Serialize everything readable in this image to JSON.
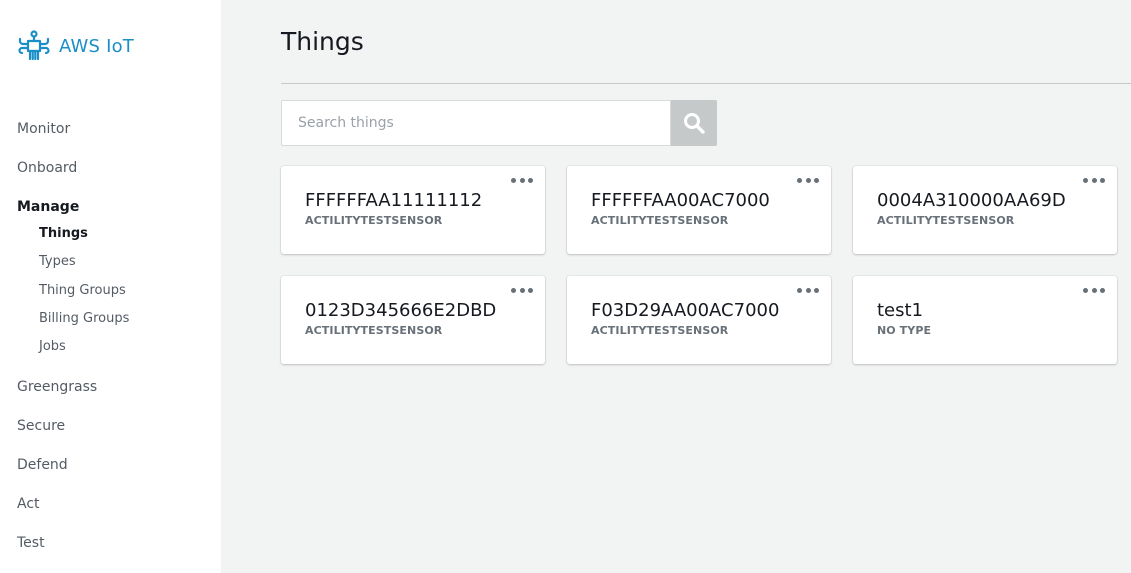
{
  "brand": {
    "name": "AWS IoT",
    "icon": "aws-iot-logo-icon",
    "color": "#1a8fc7"
  },
  "sidebar": {
    "items": [
      {
        "label": "Monitor"
      },
      {
        "label": "Onboard"
      },
      {
        "label": "Manage"
      },
      {
        "label": "Greengrass"
      },
      {
        "label": "Secure"
      },
      {
        "label": "Defend"
      },
      {
        "label": "Act"
      },
      {
        "label": "Test"
      }
    ],
    "manage_sub": [
      {
        "label": "Things"
      },
      {
        "label": "Types"
      },
      {
        "label": "Thing Groups"
      },
      {
        "label": "Billing Groups"
      },
      {
        "label": "Jobs"
      }
    ],
    "active_item": "Manage",
    "active_sub": "Things"
  },
  "page": {
    "title": "Things"
  },
  "search": {
    "placeholder": "Search things",
    "value": "",
    "icon": "search-icon"
  },
  "things": [
    {
      "name": "FFFFFFAA11111112",
      "type": "ACTILITYTESTSENSOR"
    },
    {
      "name": "FFFFFFAA00AC7000",
      "type": "ACTILITYTESTSENSOR"
    },
    {
      "name": "0004A310000AA69D",
      "type": "ACTILITYTESTSENSOR"
    },
    {
      "name": "0123D345666E2DBD",
      "type": "ACTILITYTESTSENSOR"
    },
    {
      "name": "F03D29AA00AC7000",
      "type": "ACTILITYTESTSENSOR"
    },
    {
      "name": "test1",
      "type": "NO TYPE"
    }
  ],
  "card_menu_icon": "more-horizontal-icon"
}
